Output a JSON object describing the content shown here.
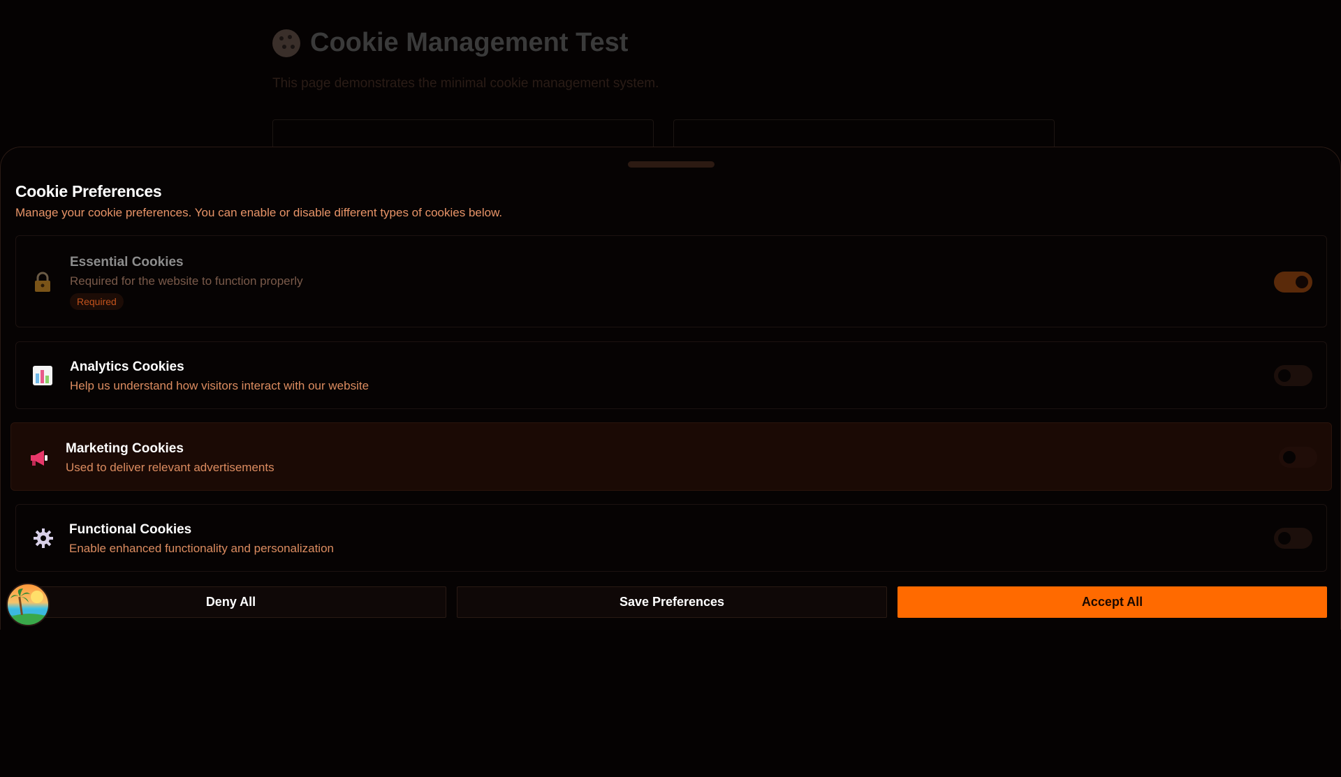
{
  "background_page": {
    "title": "Cookie Management Test",
    "subtitle": "This page demonstrates the minimal cookie management system."
  },
  "sheet": {
    "title": "Cookie Preferences",
    "description": "Manage your cookie preferences. You can enable or disable different types of cookies below."
  },
  "categories": [
    {
      "name": "Essential Cookies",
      "description": "Required for the website to function properly",
      "badge": "Required",
      "icon": "lock-icon",
      "enabled": true,
      "disabled": true
    },
    {
      "name": "Analytics Cookies",
      "description": "Help us understand how visitors interact with our website",
      "icon": "bar-chart-icon",
      "enabled": false
    },
    {
      "name": "Marketing Cookies",
      "description": "Used to deliver relevant advertisements",
      "icon": "megaphone-icon",
      "enabled": false,
      "highlighted": true
    },
    {
      "name": "Functional Cookies",
      "description": "Enable enhanced functionality and personalization",
      "icon": "gear-icon",
      "enabled": false
    }
  ],
  "buttons": {
    "deny": "Deny All",
    "save": "Save Preferences",
    "accept": "Accept All"
  },
  "colors": {
    "accent": "#ff6a00",
    "background": "#050202",
    "description_text": "#e89468"
  }
}
